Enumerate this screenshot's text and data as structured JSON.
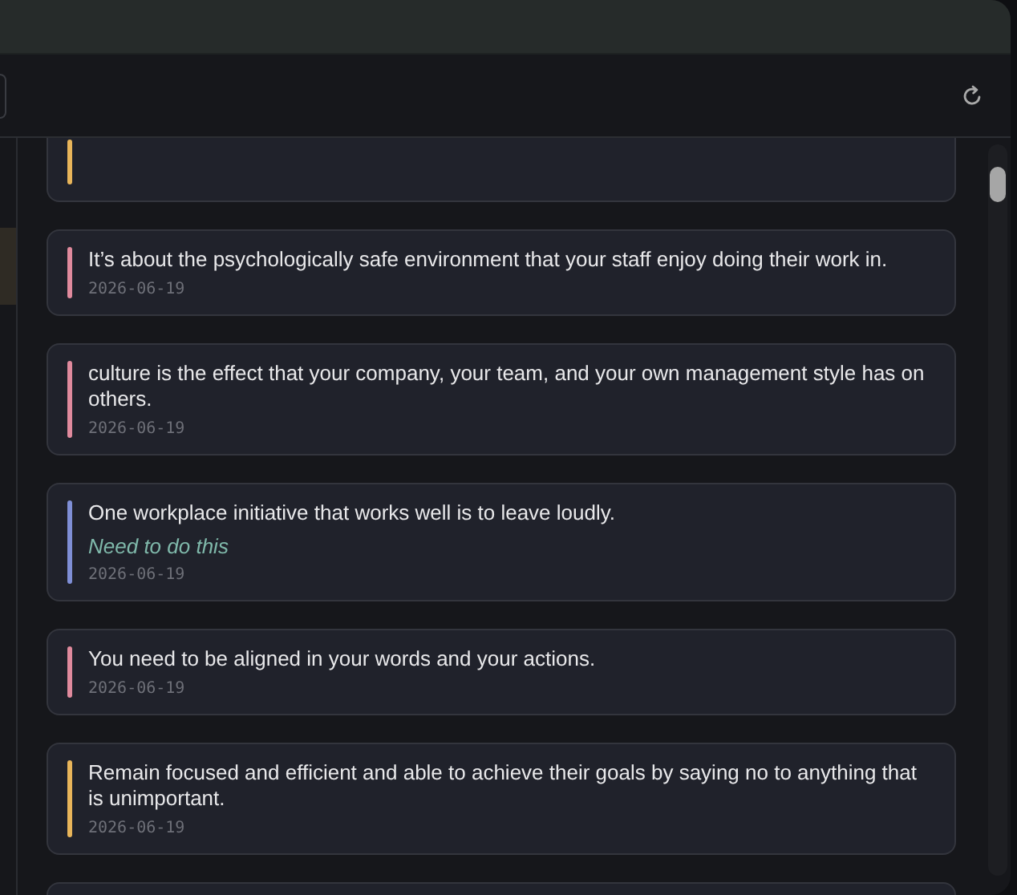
{
  "notes": [
    {
      "color": "#e8b55a"
    },
    {
      "text": "It’s about the psychologically safe environment that your staff enjoy doing their work in.",
      "date": "2026-06-19",
      "color": "#e08a9d"
    },
    {
      "text": "culture is the effect that your company, your team, and your own management style has on others.",
      "date": "2026-06-19",
      "color": "#e08a9d"
    },
    {
      "text": "One workplace initiative that works well is to leave loudly.",
      "comment": "Need to do this",
      "date": "2026-06-19",
      "color": "#7f8fd6"
    },
    {
      "text": "You need to be aligned in your words and your actions.",
      "date": "2026-06-19",
      "color": "#e08a9d"
    },
    {
      "text": "Remain focused and efficient and able to achieve their goals by saying no to anything that is unimportant.",
      "date": "2026-06-19",
      "color": "#e8b55a"
    }
  ]
}
